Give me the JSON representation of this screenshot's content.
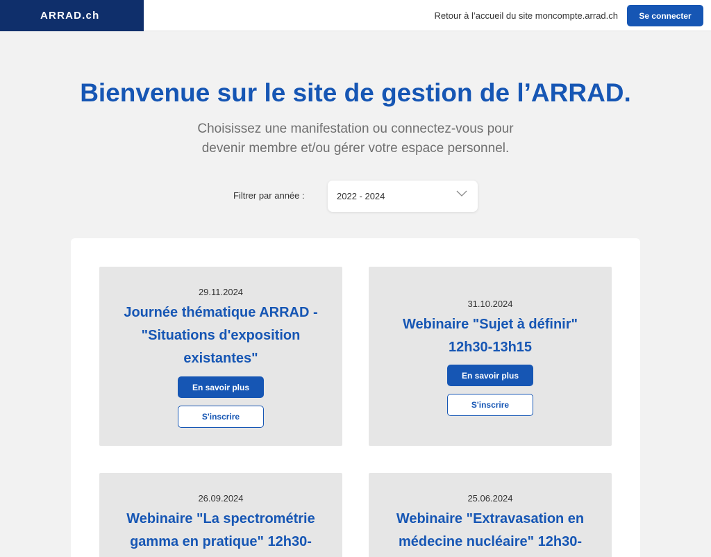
{
  "header": {
    "logo": "ARRAD.ch",
    "home_link": "Retour à l’accueil du site moncompte.arrad.ch",
    "login_button": "Se connecter"
  },
  "hero": {
    "title": "Bienvenue sur le site de gestion de l’ARRAD.",
    "subtitle_lines": [
      "Choisissez une manifestation ou connectez-vous pour",
      "devenir membre et/ou gérer votre espace personnel."
    ]
  },
  "filter": {
    "label": "Filtrer par année :",
    "selected": "2022 - 2024",
    "icon": "chevron-down-icon"
  },
  "events": [
    {
      "date": "29.11.2024",
      "title_lines": [
        "Journée thématique ARRAD -",
        "\"Situations d'exposition",
        "existantes\""
      ],
      "more_label": "En savoir plus",
      "subscribe_label": "S'inscrire"
    },
    {
      "date": "31.10.2024",
      "title_lines": [
        "Webinaire \"Sujet à définir\"",
        "12h30-13h15"
      ],
      "more_label": "En savoir plus",
      "subscribe_label": "S'inscrire"
    },
    {
      "date": "26.09.2024",
      "title_lines": [
        "Webinaire \"La spectrométrie",
        "gamma en pratique\" 12h30-"
      ]
    },
    {
      "date": "25.06.2024",
      "title_lines": [
        "Webinaire \"Extravasation en",
        "médecine nucléaire\" 12h30-"
      ]
    }
  ],
  "colors": {
    "brand_dark": "#0f2f6b",
    "accent": "#1656b4",
    "background": "#f2f2f2",
    "card": "#e6e6e6"
  }
}
